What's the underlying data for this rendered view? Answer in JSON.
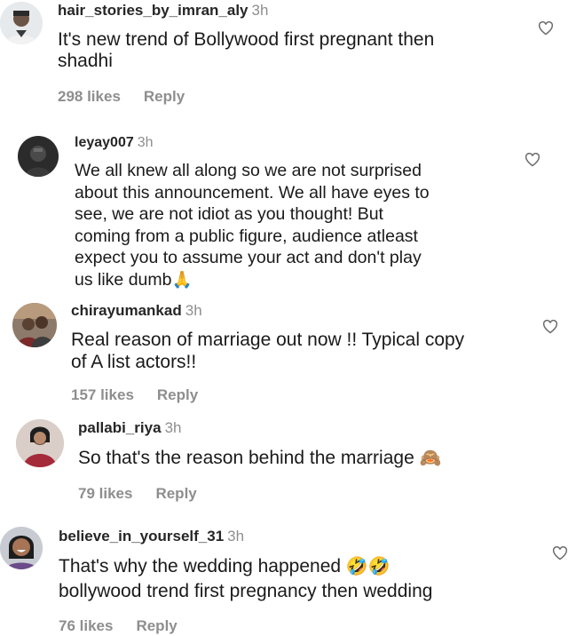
{
  "comments": [
    {
      "username": "hair_stories_by_imran_aly",
      "time": "3h",
      "lines": [
        "It's new trend of Bollywood first pregnant then",
        "shadhi"
      ],
      "likes": "298 likes",
      "reply": "Reply",
      "avatar_icon": "man-portrait-avatar"
    },
    {
      "username": "leyay007",
      "time": "3h",
      "lines": [
        "We all knew all along so we are not surprised",
        "about this announcement. We all have eyes to",
        "see, we are not idiot as you thought! But",
        "coming from a public figure, audience atleast",
        "expect you to assume your act and don't play",
        "us like dumb"
      ],
      "emoji": "🙏",
      "avatar_icon": "dark-photo-avatar"
    },
    {
      "username": "chirayumankad",
      "time": "3h",
      "lines": [
        "Real reason of marriage out now !! Typical copy",
        "of A list actors!!"
      ],
      "likes": "157 likes",
      "reply": "Reply",
      "avatar_icon": "couple-photo-avatar"
    },
    {
      "username": "pallabi_riya",
      "time": "3h",
      "lines": [
        "So that's the reason behind the marriage"
      ],
      "emoji": "🙈",
      "likes": "79 likes",
      "reply": "Reply",
      "avatar_icon": "woman-red-dress-avatar"
    },
    {
      "username": "believe_in_yourself_31",
      "time": "3h",
      "lines": [
        "That's why the wedding happened",
        "bollywood trend first pregnancy then wedding"
      ],
      "emoji": "🤣🤣",
      "likes": "76 likes",
      "reply": "Reply",
      "avatar_icon": "smiling-woman-avatar"
    }
  ],
  "colors": {
    "username": "#262626",
    "muted": "#8e8e8e",
    "text": "#1a1a1a"
  }
}
